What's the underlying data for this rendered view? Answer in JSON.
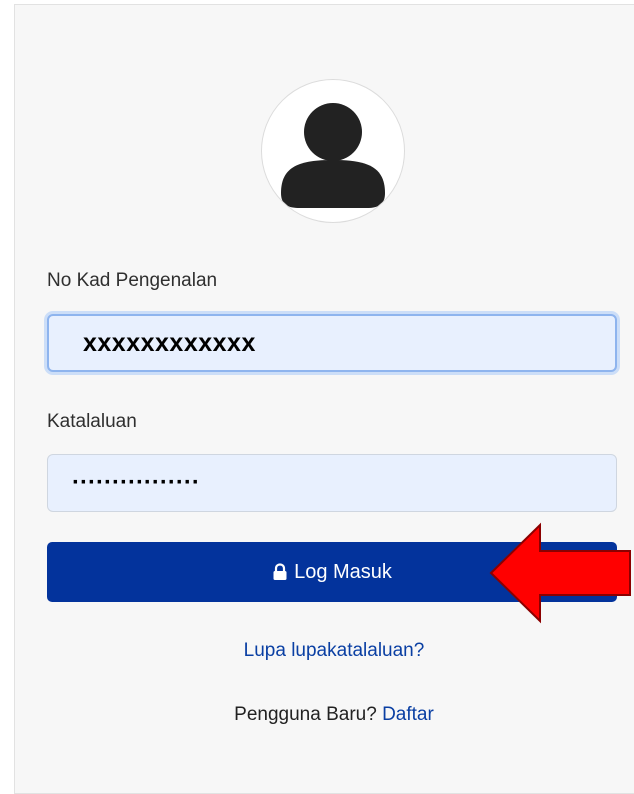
{
  "form": {
    "ic_label": "No Kad Pengenalan",
    "ic_value": "xxxxxxxxxxxx",
    "password_label": "Katalaluan",
    "password_value": "················",
    "login_button_label": "Log Masuk",
    "forgot_link": "Lupa lupakatalaluan?",
    "new_user_text": "Pengguna Baru?",
    "register_link": "Daftar"
  },
  "icons": {
    "avatar": "user-silhouette-icon",
    "button": "lock-icon",
    "annotation": "red-arrow-left"
  },
  "colors": {
    "primary_button": "#03339c",
    "link": "#0a3fa3",
    "input_fill": "#e8f0fe",
    "annotation_arrow": "#ff0000"
  }
}
